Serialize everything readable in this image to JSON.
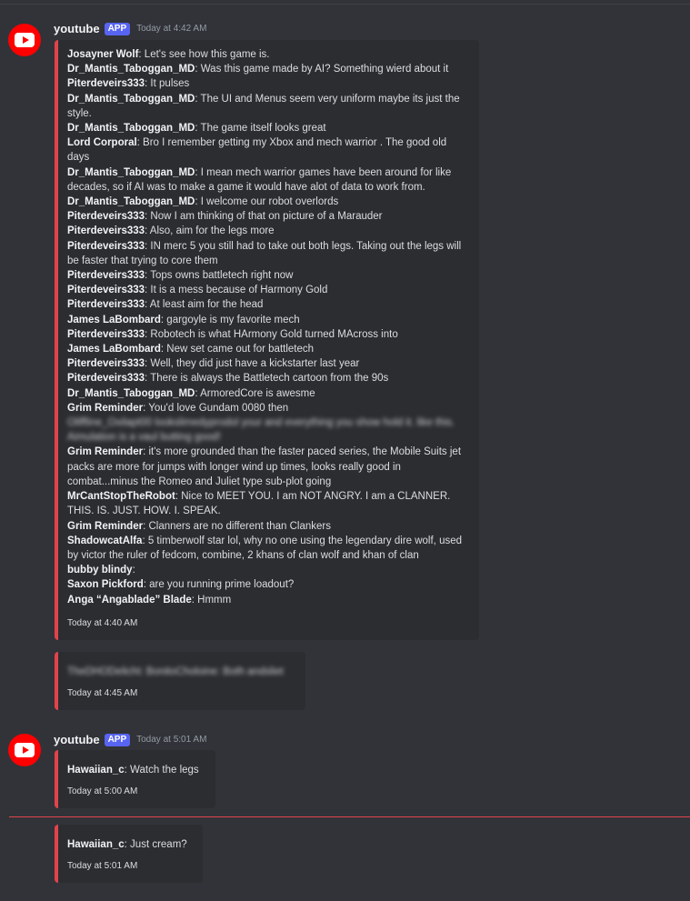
{
  "messages": [
    {
      "author": "youtube",
      "badge": "APP",
      "timestamp": "Today at 4:42 AM",
      "embed1": {
        "lines": [
          {
            "name": "Josayner Wolf",
            "text": ": Let's see how this game is."
          },
          {
            "name": "Dr_Mantis_Taboggan_MD",
            "text": ": Was this game made by AI? Something wierd about it"
          },
          {
            "name": "Piterdeveirs333",
            "text": ": It pulses"
          },
          {
            "name": "Dr_Mantis_Taboggan_MD",
            "text": ": The UI and Menus seem very uniform maybe its just the style."
          },
          {
            "name": "Dr_Mantis_Taboggan_MD",
            "text": ": The game itself looks great"
          },
          {
            "name": "Lord Corporal",
            "text": ": Bro I remember getting my Xbox and mech warrior . The good old days"
          },
          {
            "name": "Dr_Mantis_Taboggan_MD",
            "text": ": I mean mech warrior games have been around for like decades, so if AI was to make a game it would have alot of data to work from."
          },
          {
            "name": "Dr_Mantis_Taboggan_MD",
            "text": ": I welcome our robot overlords"
          },
          {
            "name": "Piterdeveirs333",
            "text": ": Now I am thinking of that on picture of a Marauder"
          },
          {
            "name": "Piterdeveirs333",
            "text": ": Also, aim for the legs more"
          },
          {
            "name": "Piterdeveirs333",
            "text": ": IN merc 5 you still had to take out both legs. Taking out the legs will be faster that trying to core them"
          },
          {
            "name": "Piterdeveirs333",
            "text": ": Tops owns battletech right now"
          },
          {
            "name": "Piterdeveirs333",
            "text": ": It is a mess because of Harmony Gold"
          },
          {
            "name": "Piterdeveirs333",
            "text": ": At least aim for the head"
          },
          {
            "name": "James LaBombard",
            "text": ": gargoyle is my favorite mech"
          },
          {
            "name": "Piterdeveirs333",
            "text": ": Robotech is what HArmony Gold turned MAcross into"
          },
          {
            "name": "James LaBombard",
            "text": ": New set came out for battletech"
          },
          {
            "name": "Piterdeveirs333",
            "text": ": Well, they did just have a kickstarter last year"
          },
          {
            "name": "Piterdeveirs333",
            "text": ": There is always the Battletech cartoon from the 90s"
          },
          {
            "name": "Dr_Mantis_Taboggan_MD",
            "text": ": ArmoredCore is awesme"
          },
          {
            "name": "Grim Reminder",
            "text": ": You'd love Gundam 0080 then"
          }
        ],
        "blurred_a": "Oliffline_Oxilapt00 lookslimedyprodol your and everything you show hold it. like this. Aimulation is a vaul butting good!",
        "lines2": [
          {
            "name": "Grim Reminder",
            "text": ": it's more grounded than the faster paced series, the Mobile Suits jet packs are more for jumps with longer wind up times, looks really good in combat...minus the Romeo and Juliet type sub-plot going"
          },
          {
            "name": "MrCantStopTheRobot",
            "text": ": Nice to MEET YOU. I am NOT ANGRY. I am a CLANNER. THIS. IS. JUST. HOW. I. SPEAK."
          },
          {
            "name": "Grim Reminder",
            "text": ": Clanners are no different than Clankers"
          },
          {
            "name": "ShadowcatAlfa",
            "text": ": 5 timberwolf star lol, why no one using the legendary dire wolf, used by victor the ruler of fedcom, combine, 2 khans of clan wolf and khan of clan"
          },
          {
            "name": "bubby blindy",
            "text": ":"
          },
          {
            "name": "Saxon Pickford",
            "text": ": are you running prime loadout?"
          },
          {
            "name": "Anga “Angablade” Blade",
            "text": ": Hmmm"
          }
        ],
        "footer": "Today at 4:40 AM"
      },
      "embed2": {
        "blurred": "TheDHODelicht: BonitoCholoine: Both andsliet",
        "footer": "Today at 4:45 AM"
      }
    },
    {
      "author": "youtube",
      "badge": "APP",
      "timestamp": "Today at 5:01 AM",
      "embed1": {
        "name": "Hawaiian_c",
        "text": ": Watch the legs",
        "footer": "Today at 5:00 AM"
      },
      "embed2": {
        "name": "Hawaiian_c",
        "text": ": Just cream?",
        "footer": "Today at 5:01 AM"
      }
    }
  ],
  "colors": {
    "background": "#313338",
    "embed_bg": "#2b2d31",
    "embed_border": "#e2434b",
    "badge": "#5865f2",
    "avatar": "#ff0000"
  }
}
